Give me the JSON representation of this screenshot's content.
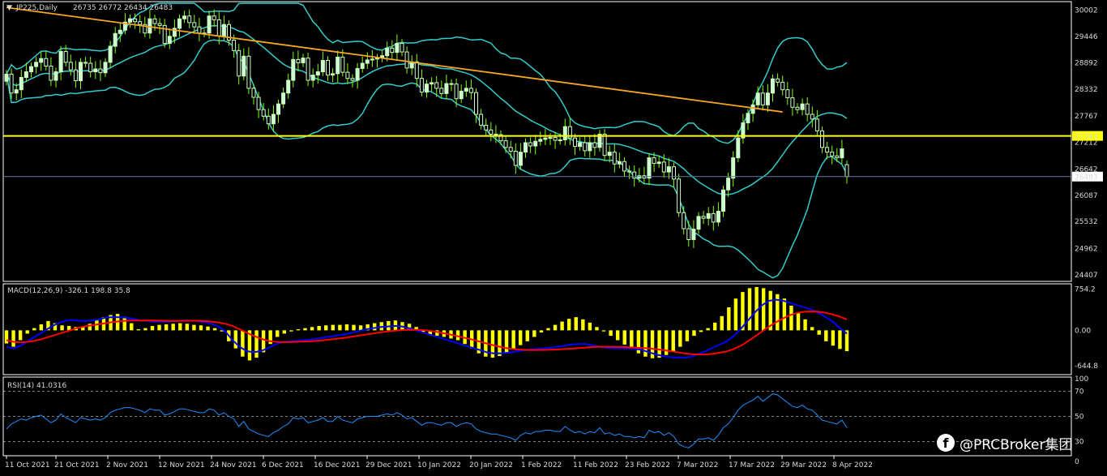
{
  "header": {
    "symbol_label": "JP225,Daily",
    "ohlc": "26735 26772 26434 26483"
  },
  "macd_label": "MACD(12,26,9) -326.1 198.8 35.8",
  "rsi_label": "RSI(14) 41.0316",
  "watermark": "@PRCBroker集团",
  "colors": {
    "bull": "#ccffcc",
    "bear": "#ccffcc",
    "wick": "#7fff00",
    "bollinger": "#33cccc",
    "trendline": "#f5a623",
    "support": "#ffff00",
    "macd_hist": "#ffff00",
    "macd_line": "#0000ff",
    "signal_line": "#ff0000",
    "rsi_line": "#1e90ff",
    "grid_dash": "#ffffff"
  },
  "chart_data": [
    {
      "type": "candlestick",
      "name": "price",
      "y_ticks": [
        "30002",
        "29446",
        "28892",
        "28332",
        "27767",
        "27212",
        "26642",
        "26087",
        "25532",
        "24962",
        "24407"
      ],
      "y_tick_values": [
        30002,
        29446,
        28892,
        28332,
        27767,
        27212,
        26642,
        26087,
        25532,
        24962,
        24407
      ],
      "ylim": [
        24300,
        30150
      ],
      "x_date_labels": [
        "11 Oct 2021",
        "21 Oct 2021",
        "2 Nov 2021",
        "12 Nov 2021",
        "24 Nov 2021",
        "6 Dec 2021",
        "16 Dec 2021",
        "29 Dec 2021",
        "10 Jan 2022",
        "20 Jan 2022",
        "1 Feb 2022",
        "11 Feb 2022",
        "23 Feb 2022",
        "7 Mar 2022",
        "17 Mar 2022",
        "29 Mar 2022",
        "8 Apr 2022"
      ],
      "support_level": 27343,
      "support_label": "27343",
      "current_price": 26483,
      "current_label": "26483",
      "trendline": {
        "start": [
          0,
          30060
        ],
        "end": [
          157,
          27850
        ]
      },
      "closes": [
        28650,
        28250,
        28320,
        28580,
        28700,
        28810,
        28900,
        28980,
        28820,
        28520,
        28700,
        29130,
        28900,
        28740,
        28510,
        28900,
        28880,
        28700,
        28760,
        28680,
        28900,
        29240,
        29510,
        29580,
        29750,
        29820,
        29760,
        29700,
        29520,
        29820,
        29720,
        29680,
        29300,
        29450,
        29620,
        29820,
        29880,
        29740,
        29650,
        29520,
        29520,
        29880,
        29800,
        29460,
        29700,
        29370,
        29150,
        28610,
        29030,
        28350,
        28160,
        27900,
        27760,
        27600,
        27800,
        28020,
        28250,
        28520,
        28960,
        28890,
        28990,
        28520,
        28630,
        28700,
        28940,
        28630,
        28660,
        29010,
        28690,
        28560,
        28520,
        28770,
        28880,
        28950,
        28970,
        28990,
        29040,
        29200,
        29110,
        29300,
        29120,
        28780,
        28910,
        28560,
        28270,
        28440,
        28470,
        28350,
        28240,
        28450,
        28440,
        28130,
        28290,
        28350,
        28260,
        27800,
        27570,
        27470,
        27380,
        27370,
        27240,
        27100,
        27020,
        26720,
        27000,
        27200,
        27130,
        27230,
        27270,
        27300,
        27310,
        27250,
        27260,
        27540,
        27300,
        27120,
        27200,
        27030,
        27200,
        27100,
        27380,
        26930,
        27000,
        26750,
        26800,
        26600,
        26580,
        26450,
        26500,
        26450,
        26880,
        26760,
        26790,
        26580,
        26690,
        26430,
        25720,
        25380,
        25150,
        25370,
        25640,
        25600,
        25700,
        25520,
        25750,
        26200,
        26450,
        26880,
        27300,
        27620,
        27820,
        28000,
        28250,
        28000,
        28250,
        28550,
        28480,
        28320,
        28150,
        27950,
        27900,
        28020,
        27800,
        27700,
        27450,
        27100,
        27000,
        26920,
        26880,
        27070,
        26483
      ],
      "opens": [
        28500,
        28650,
        28250,
        28320,
        28580,
        28700,
        28810,
        28900,
        28980,
        28820,
        28520,
        28700,
        29130,
        28900,
        28740,
        28510,
        28900,
        28880,
        28700,
        28760,
        28680,
        28900,
        29240,
        29510,
        29580,
        29750,
        29820,
        29760,
        29700,
        29520,
        29820,
        29720,
        29680,
        29300,
        29450,
        29620,
        29820,
        29880,
        29740,
        29650,
        29520,
        29520,
        29880,
        29800,
        29460,
        29700,
        29370,
        29150,
        28610,
        29030,
        28350,
        28160,
        27900,
        27760,
        27600,
        27800,
        28020,
        28250,
        28520,
        28960,
        28890,
        28990,
        28520,
        28630,
        28700,
        28940,
        28630,
        28660,
        29010,
        28690,
        28560,
        28520,
        28770,
        28880,
        28950,
        28970,
        28990,
        29040,
        29200,
        29110,
        29300,
        29120,
        28780,
        28910,
        28560,
        28270,
        28440,
        28470,
        28350,
        28240,
        28450,
        28440,
        28130,
        28290,
        28350,
        28260,
        27800,
        27570,
        27470,
        27380,
        27370,
        27240,
        27100,
        27020,
        26720,
        27000,
        27200,
        27130,
        27230,
        27270,
        27300,
        27310,
        27250,
        27260,
        27540,
        27300,
        27120,
        27200,
        27030,
        27200,
        27100,
        27380,
        26930,
        27000,
        26750,
        26800,
        26600,
        26580,
        26450,
        26500,
        26450,
        26880,
        26760,
        26790,
        26580,
        26690,
        26430,
        25720,
        25380,
        25150,
        25370,
        25640,
        25600,
        25700,
        25520,
        25750,
        26200,
        26450,
        26880,
        27300,
        27620,
        27820,
        28000,
        28250,
        28000,
        28250,
        28550,
        28480,
        28320,
        28150,
        27950,
        27900,
        28020,
        27800,
        27700,
        27450,
        27100,
        27000,
        26920,
        26880,
        26735
      ]
    },
    {
      "type": "bar+line",
      "name": "macd",
      "y_ticks": [
        "754.2",
        "0.00",
        "-644.8"
      ],
      "y_tick_values": [
        754.2,
        0,
        -644.8
      ],
      "ylim": [
        -780,
        820
      ],
      "histogram": [
        -240,
        -300,
        -180,
        -60,
        40,
        110,
        170,
        130,
        90,
        80,
        60,
        70,
        120,
        180,
        240,
        280,
        300,
        250,
        130,
        20,
        40,
        80,
        100,
        110,
        120,
        130,
        120,
        100,
        90,
        70,
        40,
        -20,
        -200,
        -330,
        -480,
        -550,
        -500,
        -400,
        -250,
        -120,
        -60,
        -20,
        20,
        40,
        60,
        80,
        90,
        100,
        100,
        110,
        100,
        90,
        110,
        130,
        150,
        170,
        180,
        150,
        120,
        60,
        -30,
        -80,
        -100,
        -120,
        -150,
        -180,
        -250,
        -330,
        -420,
        -480,
        -500,
        -470,
        -420,
        -350,
        -270,
        -200,
        -120,
        -40,
        40,
        100,
        160,
        210,
        240,
        200,
        140,
        60,
        -20,
        -100,
        -180,
        -260,
        -340,
        -420,
        -480,
        -510,
        -500,
        -450,
        -380,
        -300,
        -200,
        -100,
        -30,
        40,
        140,
        260,
        420,
        580,
        700,
        770,
        790,
        770,
        720,
        660,
        580,
        450,
        320,
        200,
        60,
        -80,
        -200,
        -280,
        -340,
        -380
      ],
      "macd_line": [
        -300,
        -330,
        -280,
        -200,
        -120,
        -40,
        40,
        110,
        160,
        190,
        180,
        170,
        180,
        200,
        230,
        240,
        240,
        230,
        210,
        180,
        170,
        160,
        160,
        160,
        170,
        180,
        180,
        170,
        150,
        120,
        70,
        -20,
        -180,
        -300,
        -380,
        -400,
        -380,
        -330,
        -260,
        -220,
        -200,
        -190,
        -180,
        -170,
        -150,
        -130,
        -110,
        -90,
        -70,
        -40,
        -10,
        20,
        40,
        60,
        70,
        80,
        70,
        40,
        0,
        -40,
        -80,
        -120,
        -160,
        -200,
        -240,
        -280,
        -320,
        -360,
        -400,
        -420,
        -420,
        -410,
        -390,
        -370,
        -350,
        -340,
        -330,
        -320,
        -300,
        -280,
        -260,
        -250,
        -250,
        -270,
        -300,
        -320,
        -330,
        -330,
        -330,
        -340,
        -360,
        -400,
        -440,
        -470,
        -490,
        -500,
        -500,
        -480,
        -430,
        -380,
        -320,
        -260,
        -200,
        -100,
        30,
        180,
        330,
        460,
        540,
        560,
        540,
        500,
        460,
        420,
        380,
        320,
        240,
        160,
        40,
        -60
      ],
      "signal_line": [
        -180,
        -210,
        -220,
        -210,
        -190,
        -160,
        -120,
        -80,
        -40,
        0,
        40,
        70,
        90,
        110,
        130,
        150,
        165,
        175,
        180,
        180,
        180,
        178,
        175,
        172,
        172,
        174,
        176,
        175,
        170,
        160,
        145,
        120,
        80,
        20,
        -40,
        -100,
        -150,
        -190,
        -210,
        -215,
        -215,
        -210,
        -205,
        -200,
        -190,
        -180,
        -165,
        -150,
        -135,
        -115,
        -95,
        -75,
        -55,
        -35,
        -20,
        -5,
        5,
        10,
        10,
        5,
        -10,
        -30,
        -55,
        -80,
        -110,
        -140,
        -170,
        -205,
        -240,
        -275,
        -305,
        -330,
        -345,
        -355,
        -360,
        -360,
        -358,
        -355,
        -350,
        -342,
        -335,
        -325,
        -315,
        -305,
        -300,
        -300,
        -302,
        -305,
        -310,
        -315,
        -322,
        -330,
        -345,
        -360,
        -380,
        -400,
        -420,
        -435,
        -440,
        -440,
        -430,
        -410,
        -385,
        -340,
        -280,
        -200,
        -110,
        -20,
        70,
        150,
        220,
        280,
        320,
        340,
        345,
        340,
        320,
        290,
        250,
        200
      ],
      "hist_x_start": 0
    },
    {
      "type": "line",
      "name": "rsi",
      "y_ticks": [
        "100",
        "70",
        "50",
        "30",
        "0"
      ],
      "y_tick_values": [
        100,
        70,
        50,
        30,
        0
      ],
      "ylim": [
        20,
        80
      ],
      "levels": [
        70,
        50,
        30
      ],
      "values": [
        40,
        44,
        46,
        48,
        47,
        49,
        50,
        51,
        48,
        45,
        47,
        52,
        49,
        47,
        45,
        49,
        48,
        47,
        48,
        47,
        49,
        53,
        55,
        56,
        57,
        57,
        56,
        55,
        53,
        56,
        55,
        55,
        51,
        52,
        54,
        56,
        56,
        55,
        54,
        53,
        53,
        56,
        55,
        51,
        53,
        50,
        48,
        42,
        46,
        40,
        38,
        36,
        35,
        34,
        37,
        39,
        42,
        44,
        49,
        48,
        49,
        45,
        46,
        47,
        49,
        46,
        46,
        50,
        47,
        46,
        45,
        48,
        49,
        50,
        50,
        50,
        51,
        52,
        51,
        53,
        51,
        48,
        49,
        46,
        43,
        45,
        45,
        44,
        43,
        45,
        45,
        42,
        44,
        45,
        44,
        40,
        38,
        37,
        36,
        36,
        35,
        34,
        33,
        31,
        35,
        37,
        36,
        38,
        38,
        39,
        39,
        38,
        38,
        42,
        39,
        37,
        38,
        36,
        38,
        37,
        41,
        36,
        37,
        35,
        36,
        34,
        34,
        33,
        34,
        33,
        39,
        37,
        38,
        35,
        37,
        34,
        28,
        26,
        25,
        28,
        32,
        32,
        33,
        31,
        35,
        41,
        44,
        49,
        55,
        59,
        61,
        63,
        66,
        62,
        65,
        68,
        67,
        64,
        61,
        58,
        57,
        59,
        56,
        55,
        51,
        47,
        46,
        45,
        44,
        47,
        41
      ]
    }
  ]
}
